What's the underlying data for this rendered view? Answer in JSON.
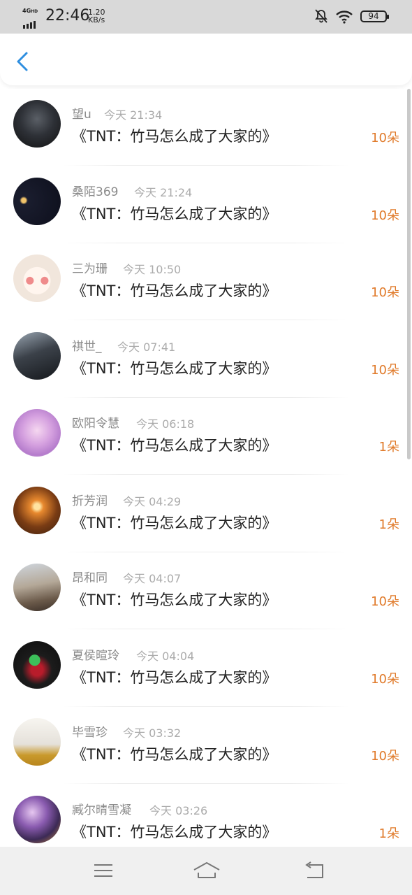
{
  "status_bar": {
    "network": "4G",
    "network_hd": "HD",
    "time": "22:46",
    "speed_value": "1.20",
    "speed_unit": "KB/s",
    "battery": "94",
    "icons": [
      "signal-icon",
      "mute-bell-icon",
      "wifi-icon",
      "battery-icon"
    ]
  },
  "header": {
    "back_icon": "chevron-left-icon",
    "accent_color": "#2f8fe0"
  },
  "list": {
    "accent_color": "#e07a2a",
    "items": [
      {
        "user": "望u",
        "time": "今天 21:34",
        "title": "《TNT：竹马怎么成了大家的》",
        "count": "10朵"
      },
      {
        "user": "桑陌369",
        "time": "今天 21:24",
        "title": "《TNT：竹马怎么成了大家的》",
        "count": "10朵"
      },
      {
        "user": "三为珊",
        "time": "今天 10:50",
        "title": "《TNT：竹马怎么成了大家的》",
        "count": "10朵"
      },
      {
        "user": "祺世_",
        "time": "今天 07:41",
        "title": "《TNT：竹马怎么成了大家的》",
        "count": "10朵"
      },
      {
        "user": "欧阳令慧",
        "time": "今天 06:18",
        "title": "《TNT：竹马怎么成了大家的》",
        "count": "1朵"
      },
      {
        "user": "折芳润",
        "time": "今天 04:29",
        "title": "《TNT：竹马怎么成了大家的》",
        "count": "1朵"
      },
      {
        "user": "昂和同",
        "time": "今天 04:07",
        "title": "《TNT：竹马怎么成了大家的》",
        "count": "10朵"
      },
      {
        "user": "夏侯暄玲",
        "time": "今天 04:04",
        "title": "《TNT：竹马怎么成了大家的》",
        "count": "10朵"
      },
      {
        "user": "毕雪珍",
        "time": "今天 03:32",
        "title": "《TNT：竹马怎么成了大家的》",
        "count": "10朵"
      },
      {
        "user": "臧尔晴雪凝",
        "time": "今天 03:26",
        "title": "《TNT：竹马怎么成了大家的》",
        "count": "1朵"
      }
    ]
  },
  "nav_bar": {
    "menu_icon": "menu-icon",
    "home_icon": "home-icon",
    "back_icon": "back-icon"
  }
}
